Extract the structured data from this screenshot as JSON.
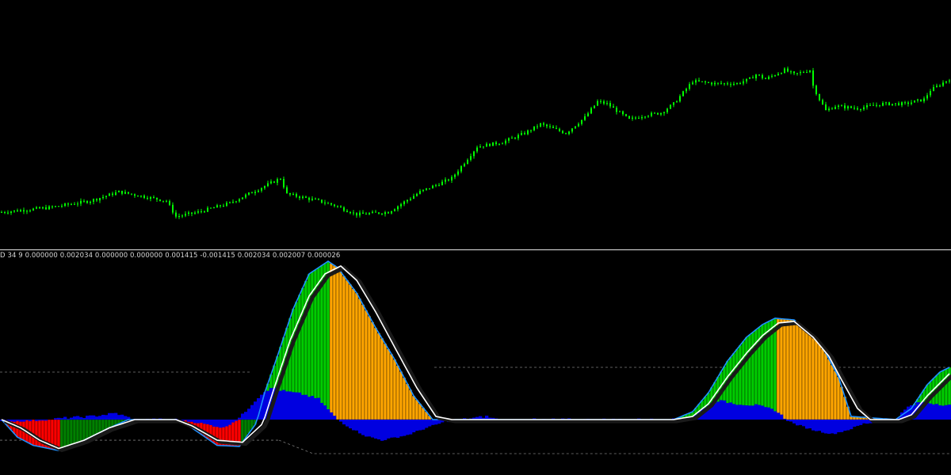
{
  "colors": {
    "background": "#000000",
    "candle": "#00ff00",
    "separator": "#c8c8c8",
    "level_line": "#7a7a7a",
    "hist_up_rising": "#00cc00",
    "hist_up_falling": "#ffa500",
    "hist_down_falling": "#ff0000",
    "hist_down_rising": "#008000",
    "secondary_histogram": "#0000e0",
    "envelope_line": "#1e90ff",
    "signal_line": "#ffffff",
    "shadow_line": "#1a1a1a"
  },
  "indicator": {
    "label": "D  34 9 0.000000 0.002034 0.000000 0.000000 0.001415 -0.001415 0.002034 0.002007 0.000026"
  },
  "chart_data": [
    {
      "type": "candlestick",
      "pane": "price",
      "grid": false,
      "legend": "none",
      "y_scale": "linear",
      "ylim": [
        0,
        100
      ],
      "n_bars": 300,
      "close_anchors": [
        [
          0,
          13
        ],
        [
          15,
          15
        ],
        [
          28,
          18
        ],
        [
          37,
          22
        ],
        [
          52,
          18
        ],
        [
          55,
          11
        ],
        [
          62,
          13
        ],
        [
          72,
          17
        ],
        [
          88,
          28
        ],
        [
          90,
          21
        ],
        [
          100,
          18
        ],
        [
          105,
          16
        ],
        [
          112,
          12
        ],
        [
          122,
          13
        ],
        [
          132,
          22
        ],
        [
          142,
          28
        ],
        [
          150,
          42
        ],
        [
          158,
          44
        ],
        [
          165,
          48
        ],
        [
          170,
          52
        ],
        [
          178,
          48
        ],
        [
          184,
          55
        ],
        [
          188,
          62
        ],
        [
          191,
          61
        ],
        [
          195,
          57
        ],
        [
          198,
          54
        ],
        [
          203,
          56
        ],
        [
          208,
          57
        ],
        [
          212,
          61
        ],
        [
          218,
          71
        ],
        [
          225,
          70
        ],
        [
          232,
          70
        ],
        [
          236,
          72
        ],
        [
          238,
          74
        ],
        [
          241,
          72
        ],
        [
          247,
          76
        ],
        [
          250,
          74
        ],
        [
          255,
          76
        ],
        [
          256,
          69
        ],
        [
          258,
          63
        ],
        [
          260,
          58
        ],
        [
          263,
          60
        ],
        [
          270,
          59
        ],
        [
          278,
          61
        ],
        [
          285,
          61
        ],
        [
          291,
          63
        ],
        [
          293,
          67
        ],
        [
          299,
          72
        ]
      ],
      "notes": "relative price levels; the screenshot prints no price scale"
    },
    {
      "type": "histogram_with_lines",
      "pane": "indicator",
      "grid": false,
      "legend": "none",
      "ylim": [
        -100,
        100
      ],
      "n_bars": 300,
      "main_envelope": [
        [
          0,
          0
        ],
        [
          5,
          -17
        ],
        [
          10,
          -25
        ],
        [
          18,
          -30
        ],
        [
          26,
          -20
        ],
        [
          34,
          -8
        ],
        [
          40,
          0
        ],
        [
          55,
          0
        ],
        [
          60,
          -8
        ],
        [
          68,
          -25
        ],
        [
          75,
          -26
        ],
        [
          80,
          -5
        ],
        [
          83,
          17
        ],
        [
          87,
          40
        ],
        [
          92,
          70
        ],
        [
          97,
          92
        ],
        [
          103,
          100
        ],
        [
          106,
          96
        ],
        [
          112,
          80
        ],
        [
          118,
          58
        ],
        [
          124,
          38
        ],
        [
          130,
          15
        ],
        [
          136,
          0
        ],
        [
          212,
          0
        ],
        [
          218,
          5
        ],
        [
          223,
          17
        ],
        [
          229,
          37
        ],
        [
          235,
          52
        ],
        [
          240,
          60
        ],
        [
          244,
          64
        ],
        [
          250,
          63
        ],
        [
          256,
          53
        ],
        [
          260,
          42
        ],
        [
          264,
          27
        ],
        [
          268,
          2
        ],
        [
          282,
          0
        ],
        [
          287,
          7
        ],
        [
          292,
          22
        ],
        [
          296,
          30
        ],
        [
          299,
          33
        ]
      ],
      "signal_envelope": [
        [
          0,
          0
        ],
        [
          6,
          -8
        ],
        [
          12,
          -20
        ],
        [
          18,
          -28
        ],
        [
          26,
          -20
        ],
        [
          34,
          -8
        ],
        [
          42,
          0
        ],
        [
          55,
          0
        ],
        [
          60,
          -6
        ],
        [
          68,
          -20
        ],
        [
          76,
          -22
        ],
        [
          82,
          -5
        ],
        [
          86,
          20
        ],
        [
          91,
          50
        ],
        [
          97,
          78
        ],
        [
          102,
          92
        ],
        [
          107,
          97
        ],
        [
          112,
          88
        ],
        [
          118,
          68
        ],
        [
          125,
          42
        ],
        [
          131,
          20
        ],
        [
          137,
          2
        ],
        [
          142,
          0
        ],
        [
          212,
          0
        ],
        [
          218,
          2
        ],
        [
          223,
          10
        ],
        [
          229,
          27
        ],
        [
          235,
          42
        ],
        [
          240,
          53
        ],
        [
          245,
          61
        ],
        [
          250,
          62
        ],
        [
          256,
          52
        ],
        [
          261,
          40
        ],
        [
          265,
          25
        ],
        [
          270,
          7
        ],
        [
          274,
          0
        ],
        [
          283,
          0
        ],
        [
          287,
          3
        ],
        [
          292,
          15
        ],
        [
          297,
          25
        ],
        [
          299,
          29
        ]
      ],
      "bar_colors": [
        "hist_up_rising",
        "hist_up_falling",
        "hist_down_falling",
        "hist_down_rising"
      ],
      "secondary_series": [
        [
          0,
          -2
        ],
        [
          10,
          -1
        ],
        [
          20,
          1
        ],
        [
          28,
          2
        ],
        [
          36,
          4
        ],
        [
          42,
          0
        ],
        [
          55,
          0
        ],
        [
          62,
          -3
        ],
        [
          70,
          -8
        ],
        [
          76,
          3
        ],
        [
          80,
          12
        ],
        [
          83,
          18
        ],
        [
          86,
          20
        ],
        [
          89,
          18
        ],
        [
          95,
          16
        ],
        [
          100,
          13
        ],
        [
          105,
          2
        ],
        [
          110,
          -8
        ],
        [
          115,
          -16
        ],
        [
          120,
          -20
        ],
        [
          128,
          -15
        ],
        [
          134,
          -8
        ],
        [
          140,
          -2
        ],
        [
          145,
          0
        ],
        [
          153,
          2
        ],
        [
          160,
          -2
        ],
        [
          165,
          0
        ],
        [
          212,
          0
        ],
        [
          218,
          1
        ],
        [
          222,
          8
        ],
        [
          226,
          12
        ],
        [
          232,
          10
        ],
        [
          238,
          9
        ],
        [
          244,
          6
        ],
        [
          250,
          -4
        ],
        [
          256,
          -10
        ],
        [
          262,
          -14
        ],
        [
          267,
          -10
        ],
        [
          272,
          -4
        ],
        [
          278,
          -2
        ],
        [
          282,
          0
        ],
        [
          286,
          8
        ],
        [
          290,
          11
        ],
        [
          295,
          10
        ],
        [
          299,
          9
        ]
      ],
      "levels": [
        30,
        33,
        -20,
        -33
      ]
    }
  ]
}
